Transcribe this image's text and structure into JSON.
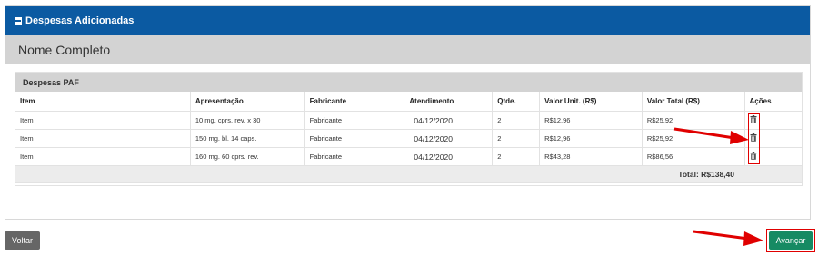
{
  "panel": {
    "title": "Despesas Adicionadas",
    "name_label": "Nome Completo"
  },
  "despesas": {
    "title": "Despesas PAF",
    "columns": [
      "Item",
      "Apresentação",
      "Fabricante",
      "Atendimento",
      "Qtde.",
      "Valor Unit. (R$)",
      "Valor Total (R$)",
      "Ações"
    ],
    "rows": [
      {
        "item": "Item",
        "apresentacao": "10 mg. cprs. rev. x 30",
        "fabricante": "Fabricante",
        "atendimento": "04/12/2020",
        "qtde": "2",
        "valor_unit": "R$12,96",
        "valor_total": "R$25,92"
      },
      {
        "item": "Item",
        "apresentacao": "150 mg. bl. 14 caps.",
        "fabricante": "Fabricante",
        "atendimento": "04/12/2020",
        "qtde": "2",
        "valor_unit": "R$12,96",
        "valor_total": "R$25,92"
      },
      {
        "item": "Item",
        "apresentacao": "160 mg. 60 cprs. rev.",
        "fabricante": "Fabricante",
        "atendimento": "04/12/2020",
        "qtde": "2",
        "valor_unit": "R$43,28",
        "valor_total": "R$86,56"
      }
    ],
    "total": "Total: R$138,40"
  },
  "buttons": {
    "voltar": "Voltar",
    "avancar": "Avançar"
  },
  "icons": {
    "header": "minus-square-icon",
    "row_action": "trash-icon",
    "annotation": "red-arrow-icon"
  },
  "colors": {
    "header_bg": "#0b5aa2",
    "section_bg": "#d3d3d3",
    "voltar_bg": "#666666",
    "avancar_bg": "#168a63",
    "annotation": "#e00000"
  }
}
